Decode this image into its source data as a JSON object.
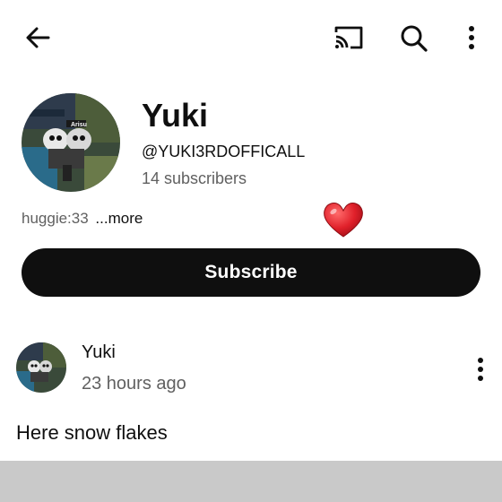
{
  "channel": {
    "name": "Yuki",
    "handle": "@YUKI3RDOFFICALL",
    "subscribers": "14 subscribers",
    "description": "huggie:33",
    "more_link": "...more",
    "avatar_label": "Arisu"
  },
  "actions": {
    "subscribe_label": "Subscribe"
  },
  "post": {
    "author": "Yuki",
    "time": "23 hours ago",
    "text": "Here snow flakes"
  },
  "icons": {
    "back": "back-arrow-icon",
    "cast": "cast-icon",
    "search": "search-icon",
    "more": "more-vert-icon",
    "heart": "heart-icon"
  },
  "colors": {
    "button_bg": "#0f0f0f",
    "heart": "#e0202a",
    "bottom_band": "#c9c9c9"
  }
}
